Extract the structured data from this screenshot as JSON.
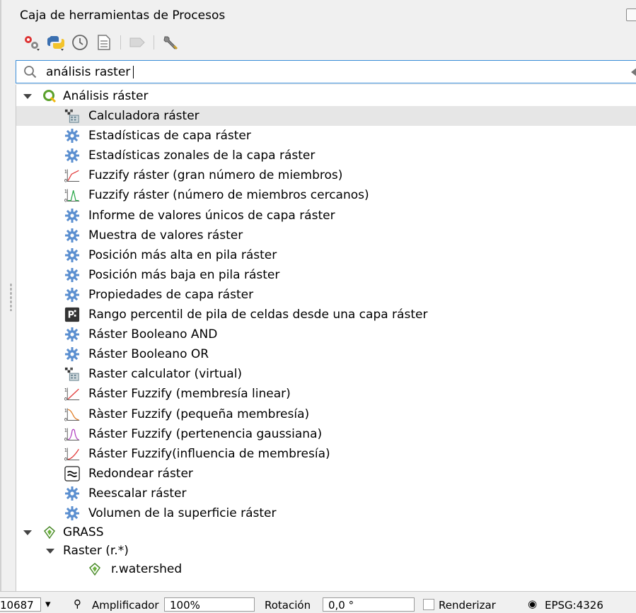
{
  "panel": {
    "title": "Caja de herramientas de Procesos",
    "toolbar": [
      {
        "name": "models-icon"
      },
      {
        "name": "python-icon"
      },
      {
        "name": "history-icon"
      },
      {
        "name": "results-icon"
      },
      {
        "name": "edit-features-icon"
      },
      {
        "name": "options-wrench-icon"
      }
    ]
  },
  "search": {
    "value": "análisis raster"
  },
  "tree": {
    "group1": "Análisis ráster",
    "items": [
      {
        "label": "Calculadora ráster",
        "icon": "raster-calculator-icon"
      },
      {
        "label": "Estadísticas de capa ráster",
        "icon": "algorithm-gear-icon"
      },
      {
        "label": "Estadísticas zonales de la capa ráster",
        "icon": "algorithm-gear-icon"
      },
      {
        "label": "Fuzzify ráster (gran número de miembros)",
        "icon": "fuzzify-large-icon"
      },
      {
        "label": "Fuzzify ráster (número de miembros cercanos)",
        "icon": "fuzzify-near-icon"
      },
      {
        "label": "Informe de valores únicos de capa ráster",
        "icon": "algorithm-gear-icon"
      },
      {
        "label": "Muestra de valores ráster",
        "icon": "algorithm-gear-icon"
      },
      {
        "label": "Posición más alta en pila ráster",
        "icon": "algorithm-gear-icon"
      },
      {
        "label": "Posición más baja en pila ráster",
        "icon": "algorithm-gear-icon"
      },
      {
        "label": "Propiedades de capa ráster",
        "icon": "algorithm-gear-icon"
      },
      {
        "label": "Rango percentil de pila de celdas desde una capa ráster",
        "icon": "percentile-icon"
      },
      {
        "label": "Ráster Booleano AND",
        "icon": "algorithm-gear-icon"
      },
      {
        "label": "Ráster Booleano OR",
        "icon": "algorithm-gear-icon"
      },
      {
        "label": "Raster calculator (virtual)",
        "icon": "raster-calculator-icon"
      },
      {
        "label": "Ráster Fuzzify (membresía linear)",
        "icon": "fuzzify-linear-icon"
      },
      {
        "label": "Ràster Fuzzify (pequeña membresía)",
        "icon": "fuzzify-small-icon"
      },
      {
        "label": "Ráster Fuzzify (pertenencia gaussiana)",
        "icon": "fuzzify-gaussian-icon"
      },
      {
        "label": "Ráster Fuzzify(influencia de membresía)",
        "icon": "fuzzify-power-icon"
      },
      {
        "label": "Redondear ráster",
        "icon": "round-raster-icon"
      },
      {
        "label": "Reescalar ráster",
        "icon": "algorithm-gear-icon"
      },
      {
        "label": "Volumen de la superficie ráster",
        "icon": "algorithm-gear-icon"
      }
    ],
    "group2": "GRASS",
    "subgroup": "Raster (r.*)",
    "leaf": "r.watershed"
  },
  "statusbar": {
    "coordinate": "10687",
    "magnifier_label": "Amplificador",
    "magnifier_value": "100%",
    "rotation_label": "Rotación",
    "rotation_value": "0,0 °",
    "render_label": "Renderizar",
    "crs": "EPSG:4326"
  },
  "colors": {
    "selection": "#e6e6e6",
    "focus_border": "#3b8fd9",
    "gear": "#5b8fd0",
    "fuzzify_line": "#e23a3a"
  }
}
